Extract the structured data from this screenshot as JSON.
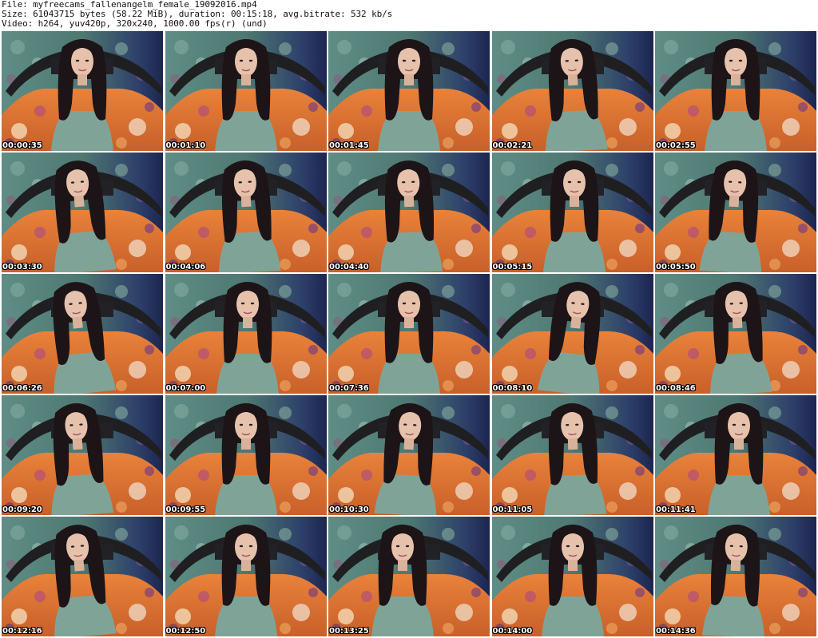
{
  "header": {
    "file_line": "File: myfreecams_fallenangelm_female_19092016.mp4",
    "size_line": "Size: 61043715 bytes (58.22 MiB), duration: 00:15:18, avg.bitrate: 532 kb/s",
    "video_line": "Video: h264, yuv420p, 320x240, 1000.00 fps(r) (und)"
  },
  "thumbnails": [
    {
      "time": "00:00:35"
    },
    {
      "time": "00:01:10"
    },
    {
      "time": "00:01:45"
    },
    {
      "time": "00:02:21"
    },
    {
      "time": "00:02:55"
    },
    {
      "time": "00:03:30"
    },
    {
      "time": "00:04:06"
    },
    {
      "time": "00:04:40"
    },
    {
      "time": "00:05:15"
    },
    {
      "time": "00:05:50"
    },
    {
      "time": "00:06:26"
    },
    {
      "time": "00:07:00"
    },
    {
      "time": "00:07:36"
    },
    {
      "time": "00:08:10"
    },
    {
      "time": "00:08:46"
    },
    {
      "time": "00:09:20"
    },
    {
      "time": "00:09:55"
    },
    {
      "time": "00:10:30"
    },
    {
      "time": "00:11:05"
    },
    {
      "time": "00:11:41"
    },
    {
      "time": "00:12:16"
    },
    {
      "time": "00:12:50"
    },
    {
      "time": "00:13:25"
    },
    {
      "time": "00:14:00"
    },
    {
      "time": "00:14:36"
    }
  ]
}
